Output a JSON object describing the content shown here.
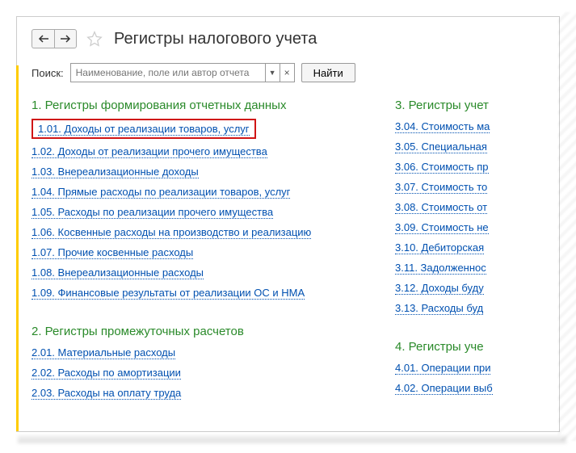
{
  "header": {
    "title": "Регистры налогового учета"
  },
  "search": {
    "label": "Поиск:",
    "placeholder": "Наименование, поле или автор отчета",
    "find_label": "Найти"
  },
  "sections_left": [
    {
      "title": "1. Регистры формирования отчетных данных",
      "items": [
        {
          "label": "1.01. Доходы от реализации товаров, услуг",
          "highlighted": true
        },
        {
          "label": "1.02. Доходы от реализации прочего имущества"
        },
        {
          "label": "1.03. Внереализационные доходы"
        },
        {
          "label": "1.04. Прямые расходы по реализации товаров, услуг"
        },
        {
          "label": "1.05. Расходы по реализации прочего имущества"
        },
        {
          "label": "1.06. Косвенные расходы на производство и реализацию"
        },
        {
          "label": "1.07. Прочие косвенные расходы"
        },
        {
          "label": "1.08. Внереализационные расходы"
        },
        {
          "label": "1.09. Финансовые результаты от реализации ОС и НМА"
        }
      ]
    },
    {
      "title": "2. Регистры промежуточных расчетов",
      "items": [
        {
          "label": "2.01. Материальные расходы"
        },
        {
          "label": "2.02. Расходы по амортизации"
        },
        {
          "label": "2.03. Расходы на оплату труда"
        }
      ]
    }
  ],
  "sections_right": [
    {
      "title": "3. Регистры учет",
      "items": [
        {
          "label": "3.04. Стоимость ма"
        },
        {
          "label": "3.05. Специальная"
        },
        {
          "label": "3.06. Стоимость пр"
        },
        {
          "label": "3.07. Стоимость то"
        },
        {
          "label": "3.08. Стоимость от"
        },
        {
          "label": "3.09. Стоимость не"
        },
        {
          "label": "3.10. Дебиторская"
        },
        {
          "label": "3.11. Задолженнос"
        },
        {
          "label": "3.12. Доходы буду"
        },
        {
          "label": "3.13. Расходы буд"
        }
      ]
    },
    {
      "title": "4. Регистры уче",
      "items": [
        {
          "label": "4.01. Операции при"
        },
        {
          "label": "4.02. Операции выб"
        }
      ]
    }
  ]
}
